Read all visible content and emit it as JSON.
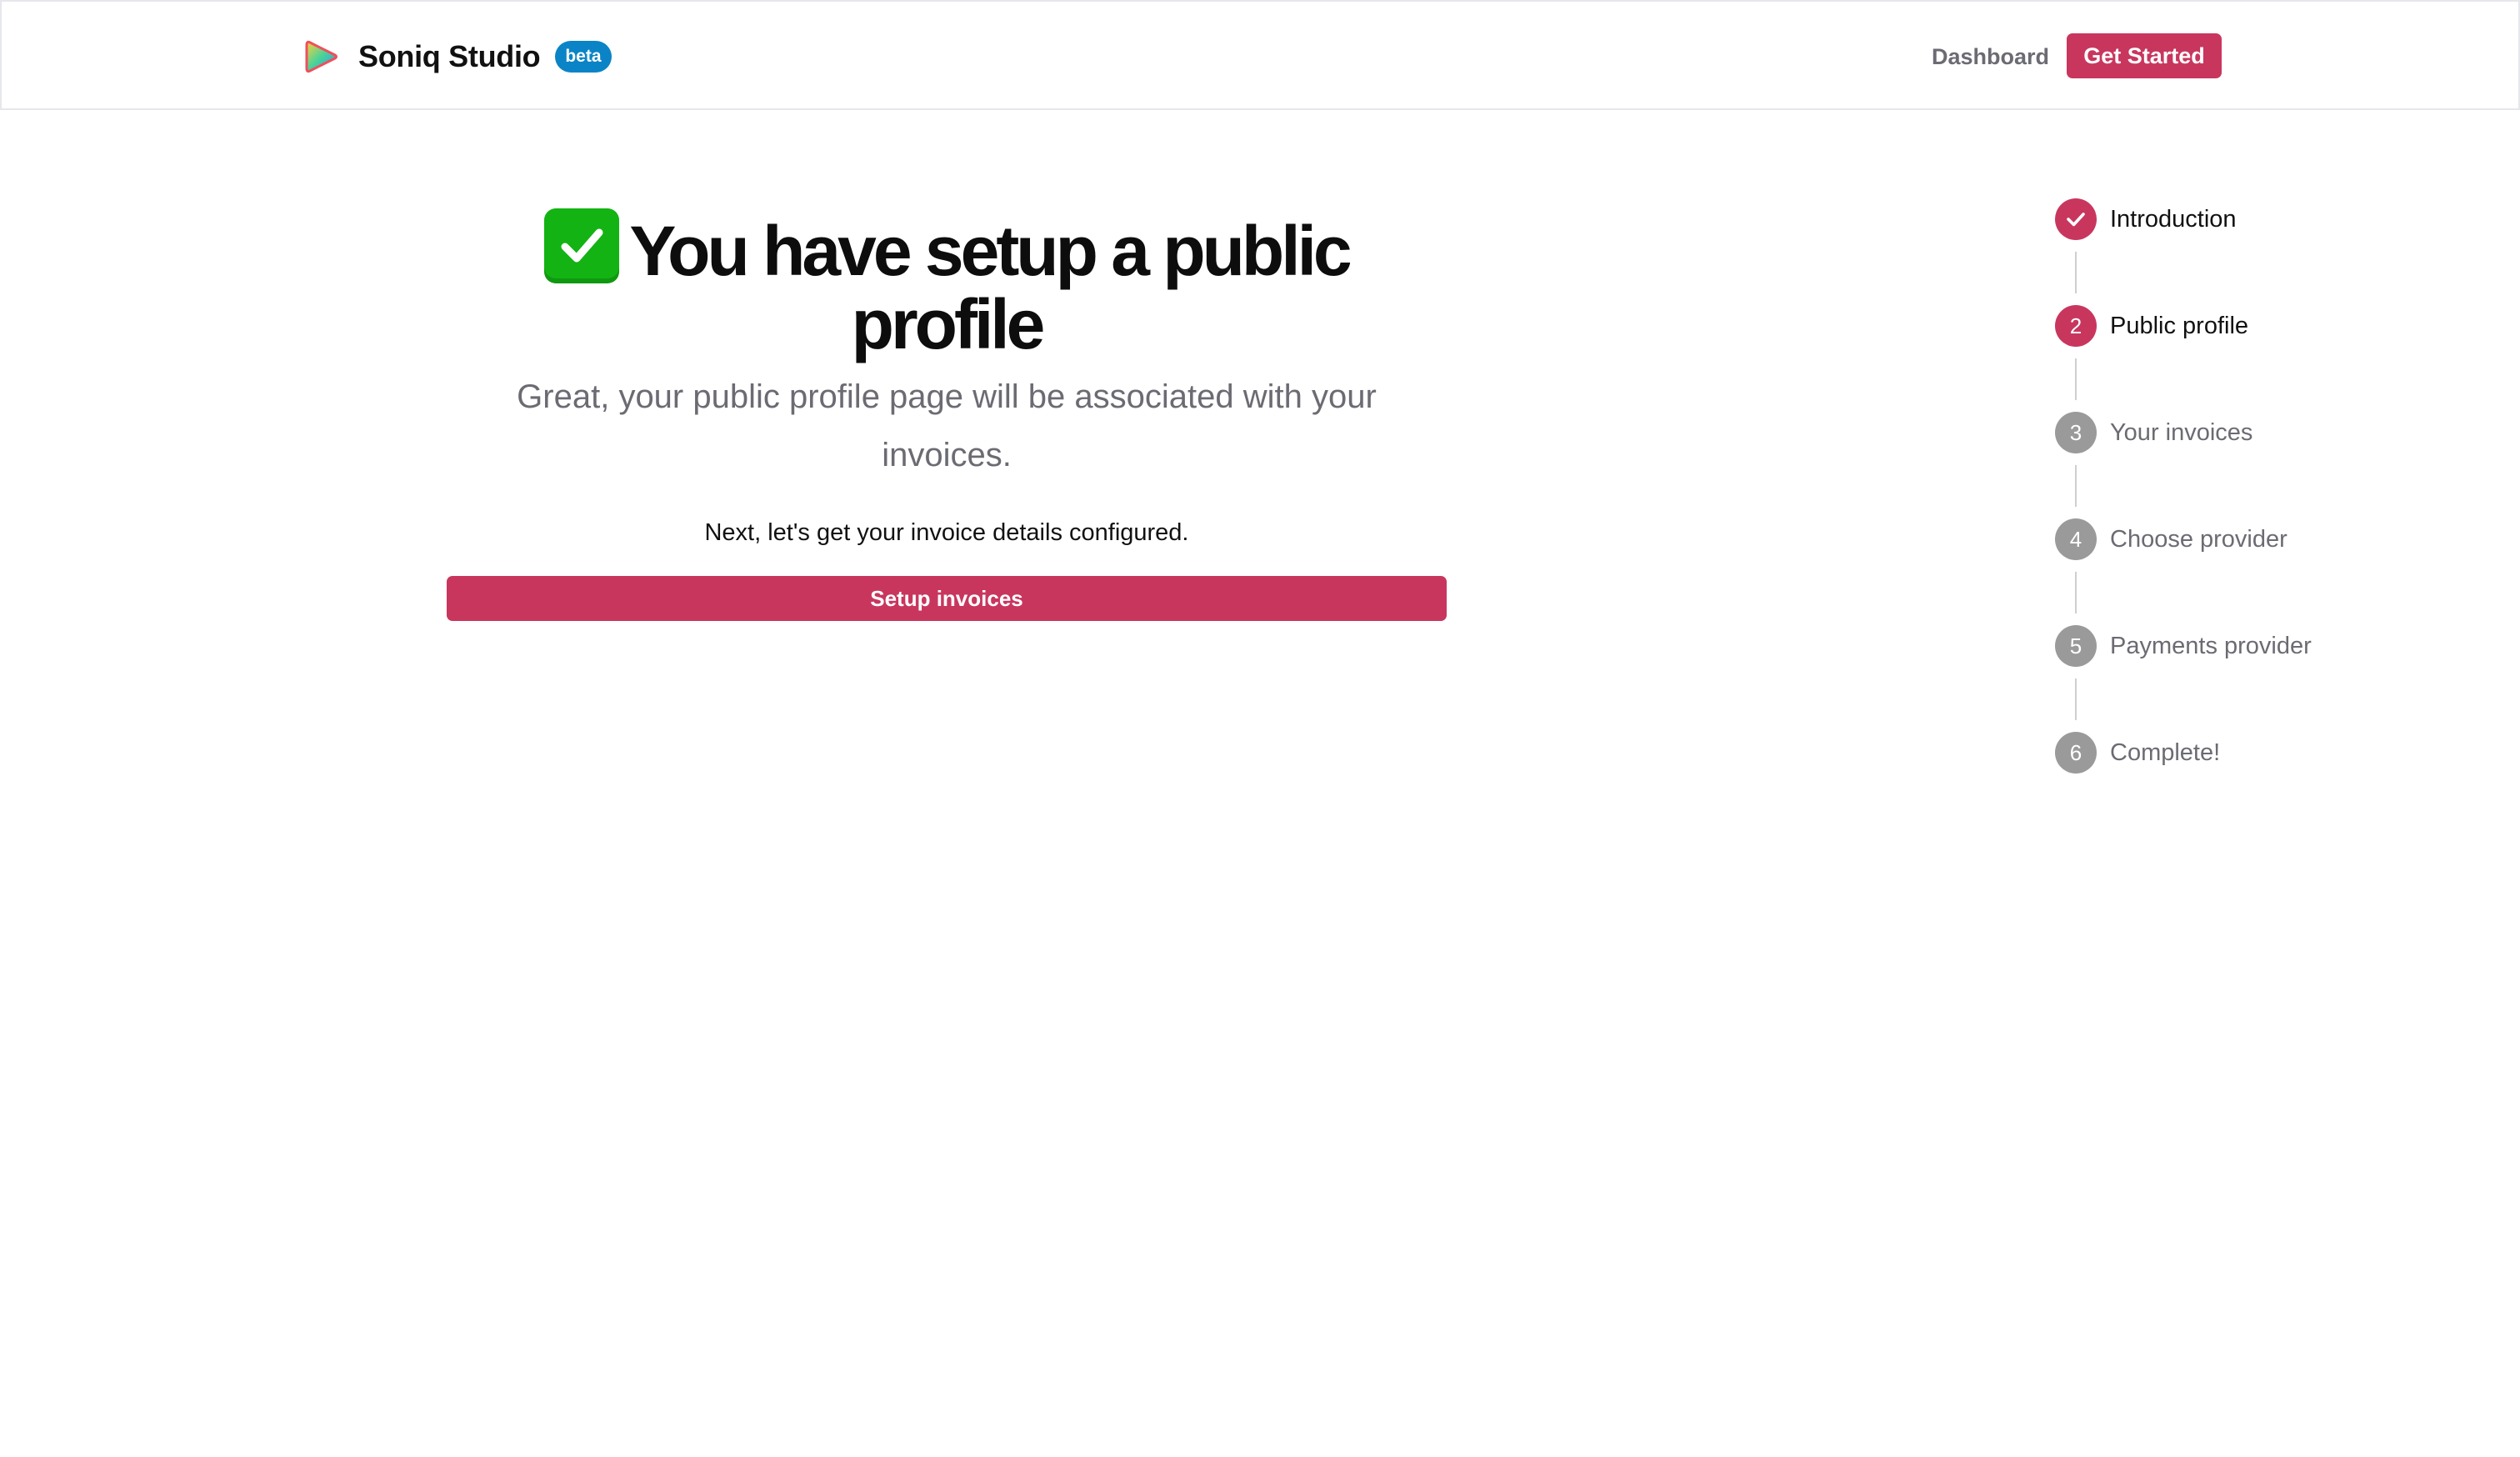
{
  "header": {
    "brand_name": "Soniq Studio",
    "beta_label": "beta",
    "dashboard_label": "Dashboard",
    "get_started_label": "Get Started"
  },
  "main": {
    "headline_emoji": "check-mark-button-icon",
    "headline": "You have setup a public profile",
    "subtitle": "Great, your public profile page will be associated with your invoices.",
    "next_text": "Next, let's get your invoice details configured.",
    "setup_button_label": "Setup invoices"
  },
  "stepper": {
    "steps": [
      {
        "number": "",
        "label": "Introduction",
        "state": "completed",
        "icon": "check-icon"
      },
      {
        "number": "2",
        "label": "Public profile",
        "state": "current"
      },
      {
        "number": "3",
        "label": "Your invoices",
        "state": "upcoming"
      },
      {
        "number": "4",
        "label": "Choose provider",
        "state": "upcoming"
      },
      {
        "number": "5",
        "label": "Payments provider",
        "state": "upcoming"
      },
      {
        "number": "6",
        "label": "Complete!",
        "state": "upcoming"
      }
    ]
  },
  "colors": {
    "accent": "#c8365e",
    "beta_badge": "#0a84c6",
    "muted_text": "#6b6b73",
    "inactive_step": "#9a9a9a"
  }
}
